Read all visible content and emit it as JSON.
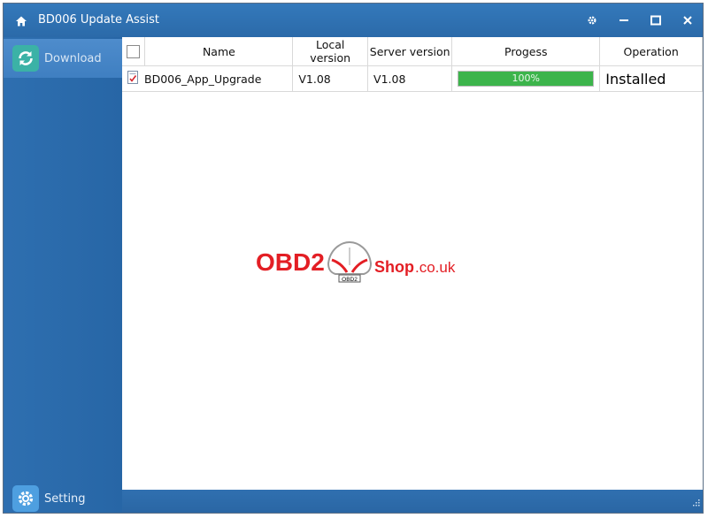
{
  "window": {
    "title": "BD006 Update Assist"
  },
  "sidebar": {
    "items": [
      {
        "label": "Download",
        "icon": "refresh-icon"
      },
      {
        "label": "Setting",
        "icon": "gear-icon"
      }
    ]
  },
  "table": {
    "headers": [
      "",
      "Name",
      "Local version",
      "Server version",
      "Progess",
      "Operation"
    ],
    "rows": [
      {
        "name": "BD006_App_Upgrade",
        "local_version": "V1.08",
        "server_version": "V1.08",
        "progress_text": "100%",
        "progress": 1.0,
        "operation": "Installed"
      }
    ]
  },
  "watermark": {
    "brand": "OBD2",
    "shop": "Shop",
    "domain": ".co.uk",
    "car_badge": "OBD2"
  },
  "colors": {
    "progress_fill": "#3cb44b",
    "accent_blue": "#2b6aa9",
    "watermark_red": "#e31e24"
  }
}
